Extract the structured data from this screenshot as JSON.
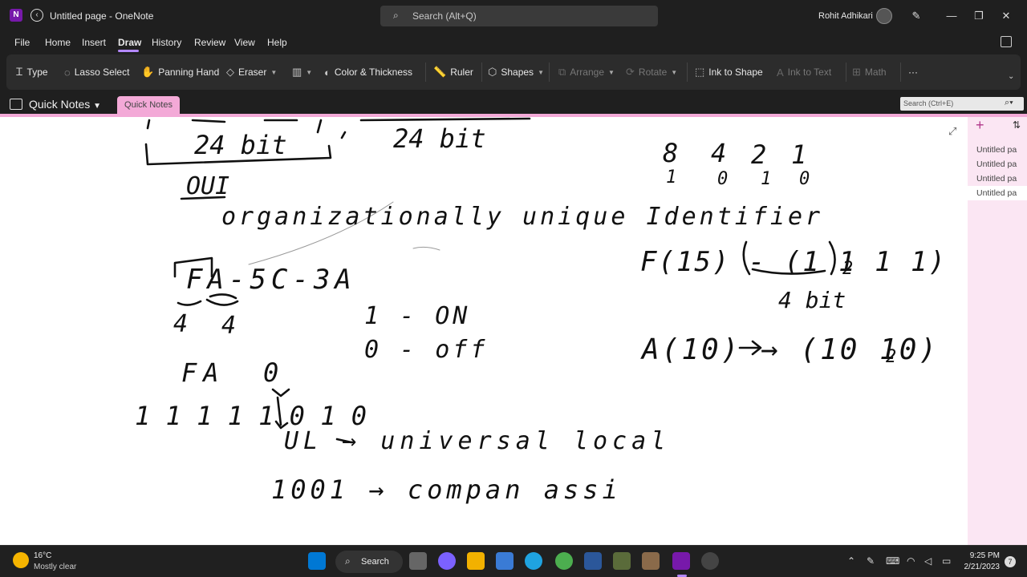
{
  "titlebar": {
    "app_icon": "N",
    "title": "Untitled page - OneNote",
    "search_placeholder": "Search (Alt+Q)",
    "user_name": "Rohit Adhikari"
  },
  "menu": {
    "items": [
      "File",
      "Home",
      "Insert",
      "Draw",
      "History",
      "Review",
      "View",
      "Help"
    ],
    "active": "Draw"
  },
  "ribbon": {
    "type": "Type",
    "lasso": "Lasso Select",
    "panning": "Panning Hand",
    "eraser": "Eraser",
    "color_thickness": "Color & Thickness",
    "ruler": "Ruler",
    "shapes": "Shapes",
    "arrange": "Arrange",
    "rotate": "Rotate",
    "ink_to_shape": "Ink to Shape",
    "ink_to_text": "Ink to Text",
    "math": "Math",
    "more": "···"
  },
  "notebook": {
    "name": "Quick Notes",
    "section_tab": "Quick Notes",
    "search_placeholder": "Search (Ctrl+E)"
  },
  "pages": [
    {
      "label": "Untitled pa",
      "selected": false
    },
    {
      "label": "Untitled pa",
      "selected": false
    },
    {
      "label": "Untitled pa",
      "selected": false
    },
    {
      "label": "Untitled pa",
      "selected": true
    }
  ],
  "ink": {
    "bits_left": "24 bit",
    "bits_right": "24 bit",
    "oui": "OUI",
    "org_full": "organizationally unique Identifier",
    "mac_example": "FA-5C-3A",
    "nibble_left": "4",
    "nibble_right": "4",
    "on": "1 - ON",
    "off": "0 - off",
    "fa": "FA",
    "zero": "0",
    "bits_row": "1 1 1 1   1 0 1 0",
    "ul": "UL → universal local",
    "company": "1001 → compan assi",
    "place_values": [
      "8",
      "4",
      "2",
      "1"
    ],
    "place_bits": [
      "1",
      "0",
      "1",
      "0"
    ],
    "f15": "F(15) - (1 1 1 1)",
    "sub2": "2",
    "four_bit": "4 bit",
    "a10": "A(10) → (10 10)"
  },
  "taskbar": {
    "temp": "16°C",
    "weather": "Mostly clear",
    "search": "Search",
    "time": "9:25 PM",
    "date": "2/21/2023",
    "notifications": "7"
  },
  "colors": {
    "accent": "#b388ff",
    "section": "#f3a9d7",
    "pagelist_bg": "#fbe6f3",
    "ink": "#111111",
    "onenote": "#7719aa"
  }
}
